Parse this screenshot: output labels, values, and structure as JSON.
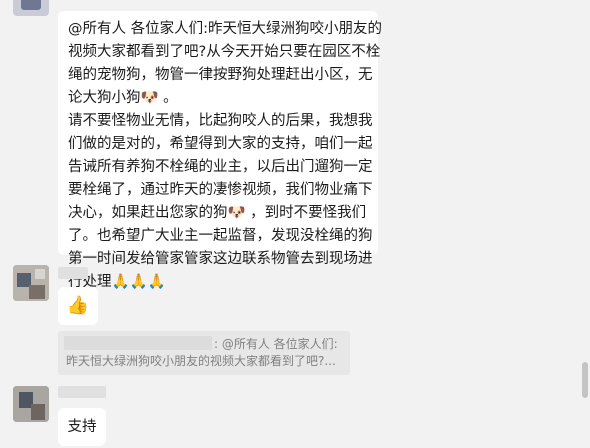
{
  "chat": {
    "messages": [
      {
        "type": "text",
        "lines": [
          "@所有人 各位家人们:昨天恒大绿洲狗咬小朋友的",
          "视频大家都看到了吧?从今天开始只要在园区不栓",
          "绳的宠物狗，物管一律按野狗处理赶出小区，无",
          "论大狗小狗🐶 。",
          "请不要怪物业无情，比起狗咬人的后果，我想我",
          "们做的是对的，希望得到大家的支持，咱们一起",
          "告诫所有养狗不栓绳的业主，以后出门遛狗一定",
          "要栓绳了，通过昨天的凄惨视频，我们物业痛下",
          "决心，如果赶出您家的狗🐶 ，到时不要怪我们",
          "了。也希望广大业主一起监督，发现没栓绳的狗",
          "第一时间发给管家管家这边联系物管去到现场进",
          "行处理🙏🙏🙏"
        ]
      },
      {
        "type": "emoji",
        "content": "👍"
      },
      {
        "type": "quote",
        "lines": [
          ": @所有人 各位家人们:",
          "昨天恒大绿洲狗咬小朋友的视频大家都看到了吧?..."
        ]
      },
      {
        "type": "text",
        "lines": [
          "支持"
        ]
      }
    ]
  }
}
